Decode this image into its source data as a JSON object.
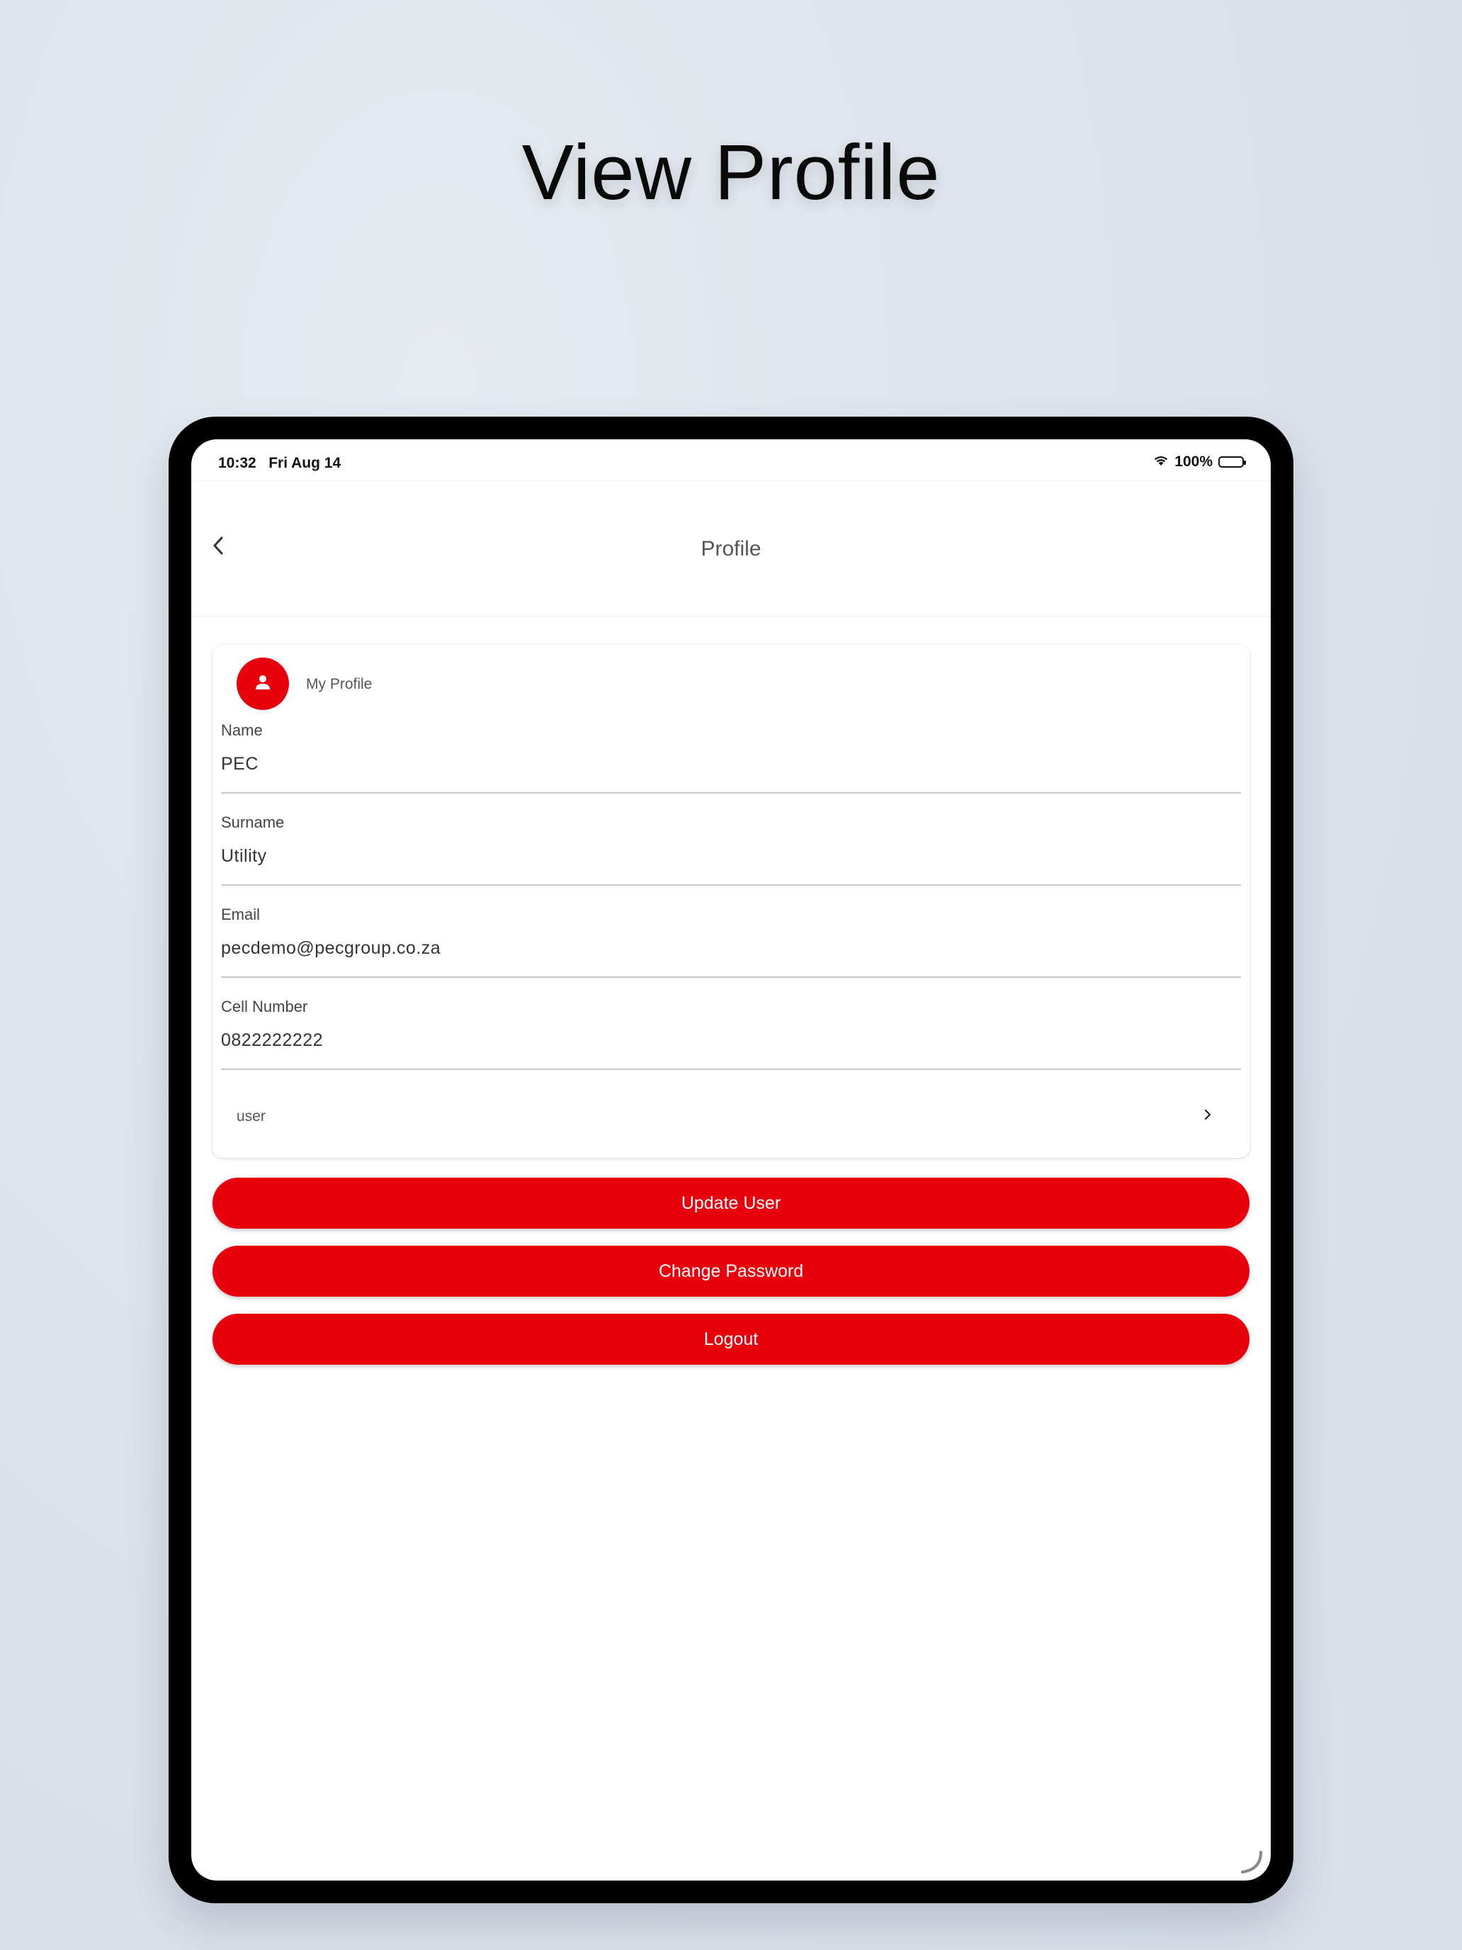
{
  "headline": "View Profile",
  "status_bar": {
    "time": "10:32",
    "date": "Fri Aug 14",
    "battery": "100%"
  },
  "nav": {
    "title": "Profile"
  },
  "profile_card": {
    "title": "My Profile",
    "fields": [
      {
        "label": "Name",
        "value": "PEC"
      },
      {
        "label": "Surname",
        "value": "Utility"
      },
      {
        "label": "Email",
        "value": "pecdemo@pecgroup.co.za"
      },
      {
        "label": "Cell Number",
        "value": "0822222222"
      }
    ],
    "role": "user"
  },
  "buttons": {
    "update": "Update User",
    "change_password": "Change Password",
    "logout": "Logout"
  },
  "colors": {
    "accent": "#e8000d",
    "background": "#dde3ec"
  },
  "icons": [
    "back-chevron-icon",
    "wifi-icon",
    "battery-icon",
    "person-icon",
    "chevron-right-icon"
  ]
}
